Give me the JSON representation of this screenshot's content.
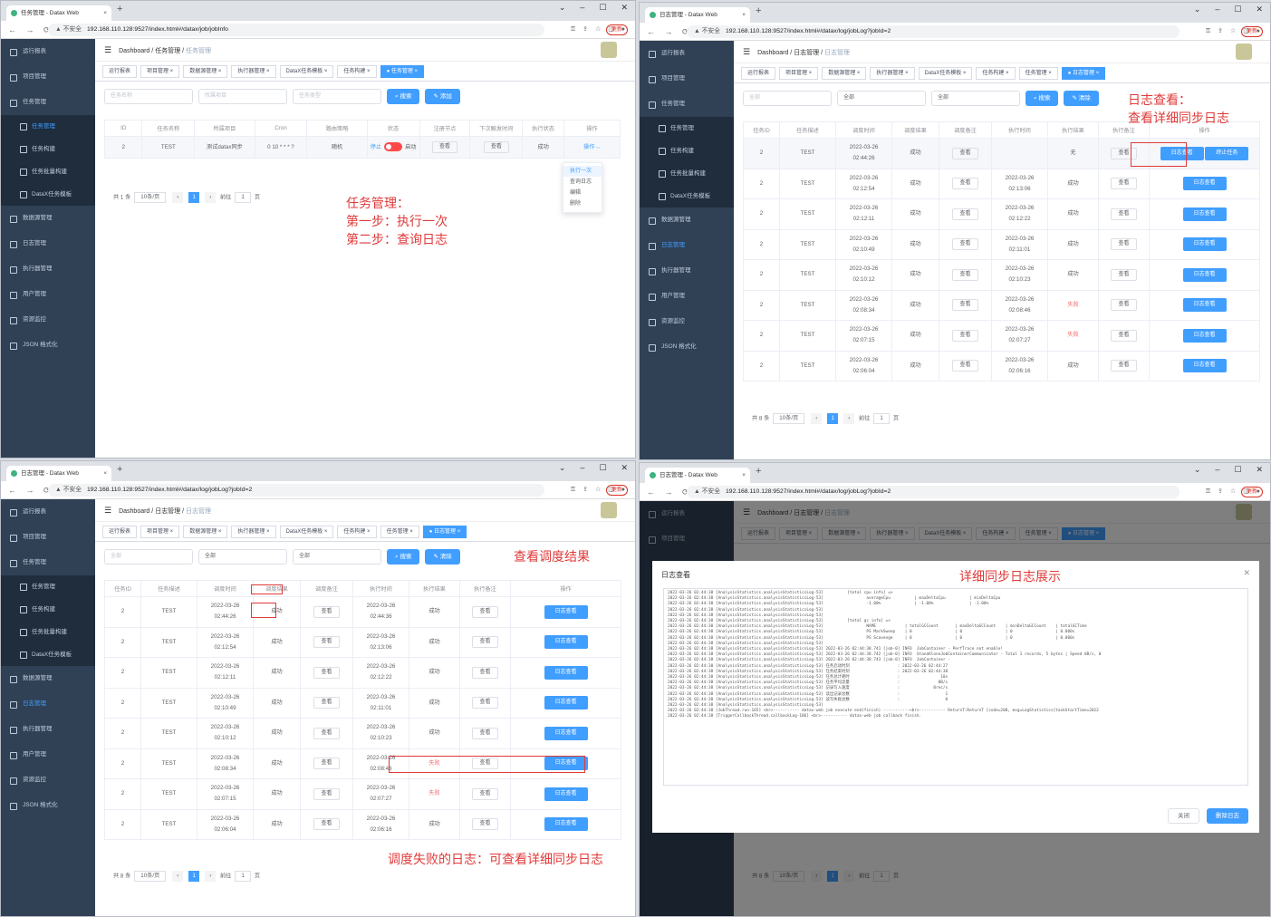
{
  "browser": {
    "tab_q1": "任务管理 - Datax Web",
    "tab_log": "日志管理 - Datax Web",
    "url_q1": "192.168.110.128:9527/index.html#/datax/job/jobInfo",
    "url_log": "192.168.110.128:9527/index.html#/datax/log/jobLog?jobId=2",
    "insecure": "不安全",
    "update": "更新"
  },
  "sidebar": {
    "items": [
      "运行报表",
      "项目管理",
      "任务管理",
      "任务管理",
      "任务构建",
      "任务批量构建",
      "DataX任务模板",
      "数据源管理",
      "日志管理",
      "执行器管理",
      "用户管理",
      "资源监控",
      "JSON 格式化"
    ]
  },
  "header": {
    "home": "Dashboard",
    "sep": "/",
    "c1_task": "任务管理",
    "c2_task": "任务管理",
    "c1_log": "日志管理",
    "c2_log": "日志管理"
  },
  "tags": {
    "q1": [
      "运行报表",
      "项目管理 ×",
      "数据源管理 ×",
      "执行器管理 ×",
      "DataX任务模板 ×",
      "任务构建 ×",
      "● 任务管理 ×"
    ],
    "log": [
      "运行报表",
      "项目管理 ×",
      "数据源管理 ×",
      "执行器管理 ×",
      "DataX任务模板 ×",
      "任务构建 ×",
      "任务管理 ×",
      "● 日志管理 ×"
    ]
  },
  "q1": {
    "filter_name": "任务名称",
    "filter_project": "所属项目",
    "filter_type": "任务类型",
    "search": "搜索",
    "add": "添加",
    "columns": [
      "ID",
      "任务名称",
      "所属项目",
      "Cron",
      "路由策略",
      "状态",
      "注册节点",
      "下次触发时间",
      "执行状态",
      "操作"
    ],
    "row": {
      "id": "2",
      "name": "TEST",
      "project": "测试datax同步",
      "cron": "0 10 * * * ?",
      "route": "随机",
      "stop": "停止",
      "start": "启动",
      "view": "查看",
      "state": "成功",
      "op": "操作 ⌵"
    },
    "dropdown": [
      "执行一次",
      "查询日志",
      "编辑",
      "删除"
    ],
    "pager": {
      "total": "共 1 条",
      "size": "10条/页",
      "page": "1",
      "goto": "前往",
      "goto_val": "1",
      "unit": "页"
    },
    "annotation": [
      "任务管理：",
      "第一步：执行一次",
      "第二步：查询日志"
    ]
  },
  "log": {
    "filter_all": "全部",
    "search": "搜索",
    "clear": "清除",
    "columns": [
      "任务ID",
      "任务描述",
      "调度时间",
      "调度结果",
      "调度备注",
      "执行时间",
      "执行结果",
      "执行备注",
      "操作"
    ],
    "rows": [
      {
        "id": "2",
        "desc": "TEST",
        "sched": "2022-03-26 02:44:26",
        "result": "成功",
        "note": "查看",
        "exec": "",
        "exec_result": "无",
        "exec_note": "查看",
        "exec_q3": "2022-03-26 02:44:36",
        "exec_result_q3": "成功"
      },
      {
        "id": "2",
        "desc": "TEST",
        "sched": "2022-03-26 02:12:54",
        "result": "成功",
        "note": "查看",
        "exec": "2022-03-26 02:13:06",
        "exec_result": "成功",
        "exec_note": "查看"
      },
      {
        "id": "2",
        "desc": "TEST",
        "sched": "2022-03-26 02:12:11",
        "result": "成功",
        "note": "查看",
        "exec": "2022-03-26 02:12:22",
        "exec_result": "成功",
        "exec_note": "查看"
      },
      {
        "id": "2",
        "desc": "TEST",
        "sched": "2022-03-26 02:10:49",
        "result": "成功",
        "note": "查看",
        "exec": "2022-03-26 02:11:01",
        "exec_result": "成功",
        "exec_note": "查看"
      },
      {
        "id": "2",
        "desc": "TEST",
        "sched": "2022-03-26 02:10:12",
        "result": "成功",
        "note": "查看",
        "exec": "2022-03-26 02:10:23",
        "exec_result": "成功",
        "exec_note": "查看"
      },
      {
        "id": "2",
        "desc": "TEST",
        "sched": "2022-03-26 02:08:34",
        "result": "成功",
        "note": "查看",
        "exec": "2022-03-26 02:08:46",
        "exec_result": "失败",
        "exec_note": "查看"
      },
      {
        "id": "2",
        "desc": "TEST",
        "sched": "2022-03-26 02:07:15",
        "result": "成功",
        "note": "查看",
        "exec": "2022-03-26 02:07:27",
        "exec_result": "失败",
        "exec_note": "查看"
      },
      {
        "id": "2",
        "desc": "TEST",
        "sched": "2022-03-26 02:06:04",
        "result": "成功",
        "note": "查看",
        "exec": "2022-03-26 02:06:16",
        "exec_result": "成功",
        "exec_note": "查看"
      }
    ],
    "view_log": "日志查看",
    "stop_task": "终止任务",
    "pager": {
      "total": "共 8 条",
      "size": "10条/页",
      "page": "1",
      "goto": "前往",
      "goto_val": "1",
      "unit": "页"
    }
  },
  "q2_annotation": [
    "日志查看：",
    "查看详细同步日志"
  ],
  "q3_annotation_top": "查看调度结果",
  "q3_annotation_bottom": "调度失败的日志：可查看详细同步日志",
  "q4": {
    "dialog_title": "日志查看",
    "annotation": "详细同步日志展示",
    "close": "关闭",
    "delete_log": "删除日志",
    "log_lines": [
      "2022-03-26 02:44:38 [AnalysisStatistics.analysisStatisticsLog-53]          [total cpu info] =>",
      "2022-03-26 02:44:38 [AnalysisStatistics.analysisStatisticsLog-53]                  averageCpu          | maxDeltaCpu          | minDeltaCpu",
      "2022-03-26 02:44:38 [AnalysisStatistics.analysisStatisticsLog-53]                  -1.00%              | -1.00%               | -1.00%",
      "2022-03-26 02:44:38 [AnalysisStatistics.analysisStatisticsLog-53]",
      "2022-03-26 02:44:38 [AnalysisStatistics.analysisStatisticsLog-53]",
      "2022-03-26 02:44:38 [AnalysisStatistics.analysisStatisticsLog-53]          [total gc info] =>",
      "2022-03-26 02:44:38 [AnalysisStatistics.analysisStatisticsLog-53]                  NAME            | totalGCCount       | maxDeltaGCCount    | minDeltaGCCount    | totalGCTime",
      "2022-03-26 02:44:38 [AnalysisStatistics.analysisStatisticsLog-53]                  PS MarkSweep    | 0                  | 0                  | 0                  | 0.000s",
      "2022-03-26 02:44:38 [AnalysisStatistics.analysisStatisticsLog-53]                  PS Scavenge     | 0                  | 0                  | 0                  | 0.000s",
      "2022-03-26 02:44:38 [AnalysisStatistics.analysisStatisticsLog-53]",
      "2022-03-26 02:44:38 [AnalysisStatistics.analysisStatisticsLog-53] 2022-03-26 02:44:38.741 [job-0] INFO  JobContainer - PerfTrace not enable!",
      "2022-03-26 02:44:38 [AnalysisStatistics.analysisStatisticsLog-53] 2022-03-26 02:44:38.742 [job-0] INFO  StandAloneJobContainerCommunicator - Total 1 records, 5 bytes | Speed 0B/s, 0",
      "2022-03-26 02:44:38 [AnalysisStatistics.analysisStatisticsLog-53] 2022-03-26 02:44:38.743 [job-0] INFO  JobContainer -",
      "2022-03-26 02:44:38 [AnalysisStatistics.analysisStatisticsLog-53] 任务启动时刻                    : 2022-03-26 02:44:27",
      "2022-03-26 02:44:38 [AnalysisStatistics.analysisStatisticsLog-53] 任务结束时刻                    : 2022-03-26 02:44:38",
      "2022-03-26 02:44:38 [AnalysisStatistics.analysisStatisticsLog-53] 任务总计耗时                    :                 10s",
      "2022-03-26 02:44:38 [AnalysisStatistics.analysisStatisticsLog-53] 任务平均流量                    :                0B/s",
      "2022-03-26 02:44:38 [AnalysisStatistics.analysisStatisticsLog-53] 记录写入速度                    :              0rec/s",
      "2022-03-26 02:44:38 [AnalysisStatistics.analysisStatisticsLog-53] 读出记录总数                    :                   1",
      "2022-03-26 02:44:38 [AnalysisStatistics.analysisStatisticsLog-53] 读写失败总数                    :                   0",
      "2022-03-26 02:44:38 [AnalysisStatistics.analysisStatisticsLog-53]",
      "2022-03-26 02:44:38 [JobThread.run-165] <br>----------- datax-web job execute end(finish) -----------<br>----------- ReturnT:ReturnT [code=200, msg=LogStatistics{taskStartTime=2022",
      "2022-03-26 02:44:38 [TriggerCallbackThread.callbackLog-186] <br>----------- datax-web job callback finish."
    ]
  }
}
